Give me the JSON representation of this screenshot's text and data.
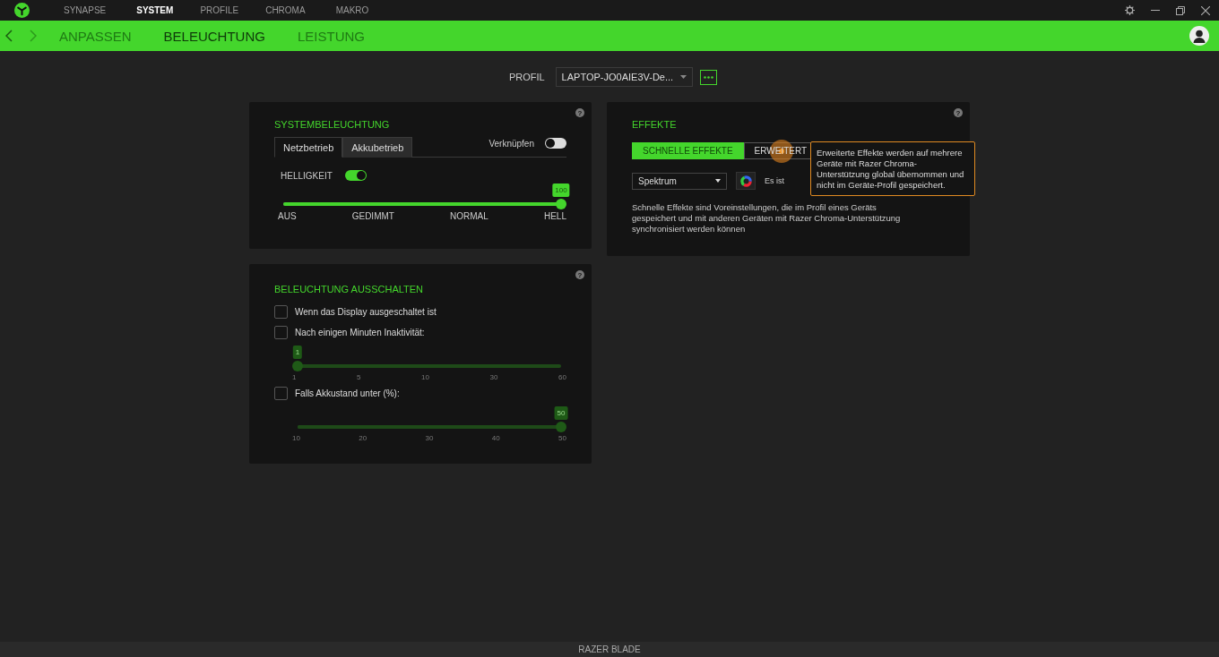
{
  "top_nav": [
    {
      "label": "SYNAPSE",
      "selected": false
    },
    {
      "label": "SYSTEM",
      "selected": true
    },
    {
      "label": "PROFILE",
      "selected": false
    },
    {
      "label": "CHROMA",
      "selected": false
    },
    {
      "label": "MAKRO",
      "selected": false
    }
  ],
  "sub_nav": [
    {
      "label": "ANPASSEN",
      "selected": false
    },
    {
      "label": "BELEUCHTUNG",
      "selected": true
    },
    {
      "label": "LEISTUNG",
      "selected": false
    }
  ],
  "profile": {
    "label": "PROFIL",
    "value": "LAPTOP-JO0AIE3V-De..."
  },
  "system_lighting": {
    "title": "SYSTEMBELEUCHTUNG",
    "help": "?",
    "tabs": [
      {
        "label": "Netzbetrieb",
        "selected": true
      },
      {
        "label": "Akkubetrieb",
        "selected": false
      }
    ],
    "link": {
      "label": "Verknüpfen",
      "on": false
    },
    "brightness": {
      "label": "HELLIGKEIT",
      "on": true
    },
    "slider": {
      "level": 1,
      "bubble": "100",
      "disabled": false,
      "ticks": [
        "AUS",
        "GEDIMMT",
        "NORMAL",
        "HELL"
      ]
    }
  },
  "lighting_off": {
    "title": "BELEUCHTUNG AUSSCHALTEN",
    "help": "?",
    "options": [
      {
        "kind": "checkbox",
        "label": "Wenn das Display ausgeschaltet ist",
        "checked": false
      },
      {
        "kind": "checkbox",
        "label": "Nach einigen Minuten Inaktivität:",
        "checked": false
      },
      {
        "kind": "slider",
        "level": 0,
        "bubble": "1",
        "disabled": true,
        "ticks": [
          "1",
          "5",
          "10",
          "30",
          "60"
        ]
      },
      {
        "kind": "checkbox",
        "label": "Falls Akkustand unter (%):",
        "checked": false
      },
      {
        "kind": "slider",
        "level": 1,
        "bubble": "50",
        "disabled": true,
        "ticks": [
          "10",
          "20",
          "30",
          "40",
          "50"
        ]
      }
    ]
  },
  "effects": {
    "title": "EFFEKTE",
    "help": "?",
    "tabs": [
      {
        "label": "SCHNELLE EFFEKTE",
        "selected": true
      },
      {
        "label": "ERWEITERT",
        "selected": false
      }
    ],
    "dropdown": "Spektrum",
    "note": "Es ist",
    "description": "Schnelle Effekte sind Voreinstellungen, die im Profil eines Geräts gespeichert und mit anderen Geräten mit Razer Chroma-Unterstützung synchronisiert werden können",
    "tooltip": "Erweiterte Effekte werden auf mehrere Geräte mit Razer Chroma-Unterstützung global übernommen und nicht im Geräte-Profil gespeichert."
  },
  "status_bar": "RAZER BLADE"
}
